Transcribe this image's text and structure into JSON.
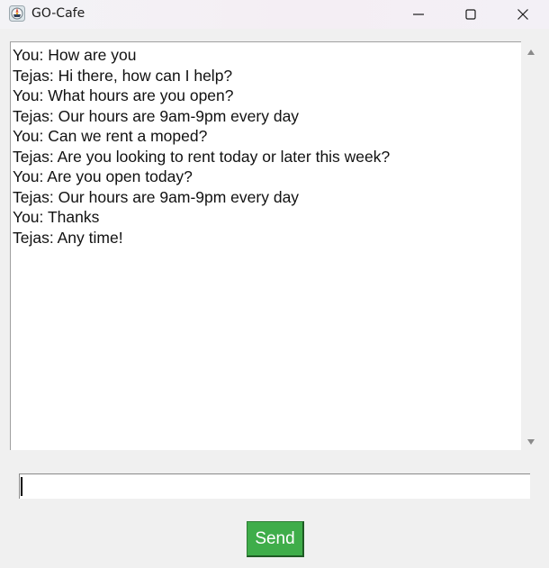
{
  "window": {
    "title": "GO-Cafe",
    "app_icon": "cafe-logo-icon",
    "controls": [
      "minimize-icon",
      "maximize-icon",
      "close-icon"
    ]
  },
  "chat": {
    "lines": [
      "You: How are you",
      "Tejas: Hi there, how can I help?",
      "You: What hours are you open?",
      "Tejas: Our hours are 9am-9pm every day",
      "You: Can we rent a moped?",
      "Tejas: Are you looking to rent today or later this week?",
      "You: Are you open today?",
      "Tejas: Our hours are 9am-9pm every day",
      "You: Thanks",
      "Tejas: Any time!"
    ]
  },
  "input": {
    "value": ""
  },
  "send_button": {
    "label": "Send",
    "color": "#3fad4a"
  },
  "colors": {
    "background": "#f0f0f0",
    "chat_background": "#ffffff"
  }
}
